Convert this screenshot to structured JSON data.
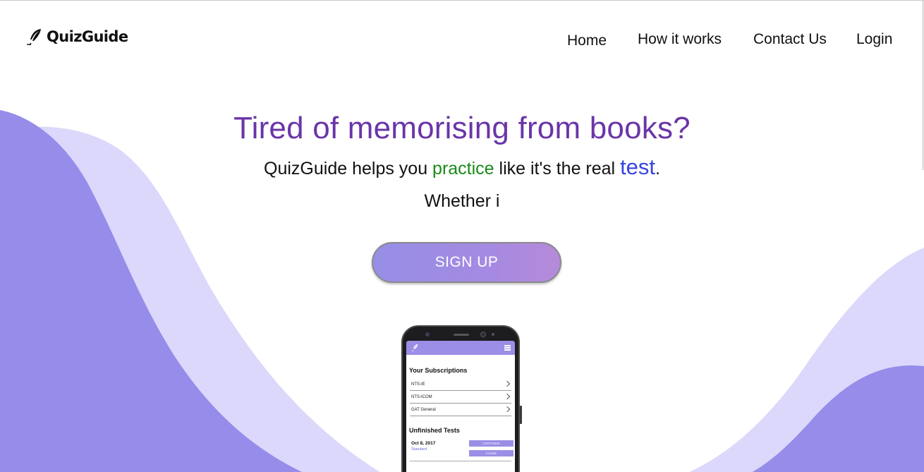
{
  "brand": {
    "name": "QuizGuide",
    "logo_icon": "feather-quill-icon"
  },
  "nav": {
    "items": [
      {
        "label": "Home"
      },
      {
        "label": "How it works"
      },
      {
        "label": "Contact Us"
      },
      {
        "label": "Login"
      }
    ]
  },
  "hero": {
    "title": "Tired of memorising from books?",
    "tagline": {
      "part1": "QuizGuide helps you ",
      "highlight1": "practice",
      "part2": " like it's the real ",
      "highlight2": "test",
      "part3": "."
    },
    "typed_text": "Whether i",
    "signup_label": "SIGN UP"
  },
  "phone_mockup": {
    "subscriptions_heading": "Your Subscriptions",
    "subscriptions": [
      "NTS-IE",
      "NTS-ICOM",
      "GAT General"
    ],
    "unfinished_heading": "Unfinished Tests",
    "unfinished": [
      {
        "date": "Oct 8, 2017",
        "type": "Standard",
        "continue_label": "CONTINUE",
        "close_label": "CLOSE"
      }
    ]
  },
  "colors": {
    "wave_dark": "#968ce9",
    "wave_light": "#dbd8fb",
    "title_purple": "#6a35a8",
    "practice_green": "#1a8a1a",
    "test_blue": "#3744e0",
    "button_gradient_start": "#968ee6",
    "button_gradient_end": "#b58ad9",
    "app_bar": "#9a8ee6"
  }
}
